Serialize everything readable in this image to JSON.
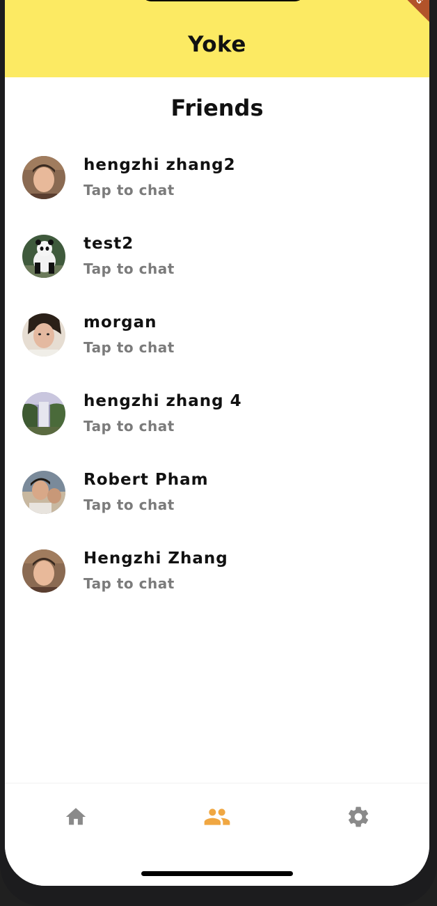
{
  "app": {
    "title": "Yoke",
    "debug_banner": "G",
    "accent_color": "#fcea63"
  },
  "page": {
    "title": "Friends"
  },
  "friends": [
    {
      "name": "hengzhi zhang2",
      "subtitle": "Tap to chat",
      "avatar": "photo-person"
    },
    {
      "name": "test2",
      "subtitle": "Tap to chat",
      "avatar": "photo-panda"
    },
    {
      "name": "morgan",
      "subtitle": "Tap to chat",
      "avatar": "photo-person"
    },
    {
      "name": "hengzhi zhang 4",
      "subtitle": "Tap to chat",
      "avatar": "photo-waterfall"
    },
    {
      "name": "Robert Pham",
      "subtitle": "Tap to chat",
      "avatar": "photo-person"
    },
    {
      "name": "Hengzhi Zhang",
      "subtitle": "Tap to chat",
      "avatar": "photo-person"
    }
  ],
  "bottom_nav": {
    "items": [
      {
        "icon": "home-icon",
        "active": false
      },
      {
        "icon": "people-icon",
        "active": true
      },
      {
        "icon": "settings-gear-icon",
        "active": false
      }
    ],
    "active_color": "#f0a742",
    "inactive_color": "#8a8a8a"
  }
}
